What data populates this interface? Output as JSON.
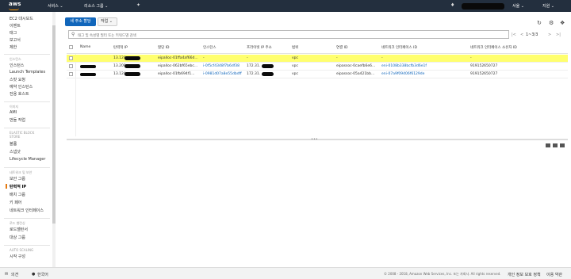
{
  "topbar": {
    "logo": "aws",
    "services": "서비스 ⌄",
    "resource_groups": "리소스 그룹 ⌄",
    "pin_icon": "pin-icon",
    "bell_icon": "bell-icon",
    "region": "서울 ⌄",
    "support": "지원 ⌄"
  },
  "sidebar": {
    "items": [
      {
        "label": "EC2 대시보드",
        "type": "item"
      },
      {
        "label": "이벤트",
        "type": "item"
      },
      {
        "label": "태그",
        "type": "item"
      },
      {
        "label": "보고서",
        "type": "item"
      },
      {
        "label": "제한",
        "type": "item"
      },
      {
        "label": "인스턴스",
        "type": "head"
      },
      {
        "label": "인스턴스",
        "type": "item"
      },
      {
        "label": "Launch Templates",
        "type": "item"
      },
      {
        "label": "스팟 요청",
        "type": "item"
      },
      {
        "label": "예약 인스턴스",
        "type": "item"
      },
      {
        "label": "전용 호스트",
        "type": "item"
      },
      {
        "label": "이미지",
        "type": "head"
      },
      {
        "label": "AMI",
        "type": "item"
      },
      {
        "label": "번들 작업",
        "type": "item"
      },
      {
        "label": "ELASTIC BLOCK",
        "type": "head"
      },
      {
        "label": "STORE",
        "type": "head2"
      },
      {
        "label": "볼륨",
        "type": "item"
      },
      {
        "label": "스냅샷",
        "type": "item"
      },
      {
        "label": "Lifecycle Manager",
        "type": "item"
      },
      {
        "label": "네트워크 및 보안",
        "type": "head"
      },
      {
        "label": "보안 그룹",
        "type": "item"
      },
      {
        "label": "탄력적 IP",
        "type": "active"
      },
      {
        "label": "배치 그룹",
        "type": "item"
      },
      {
        "label": "키 페어",
        "type": "item"
      },
      {
        "label": "네트워크 인터페이스",
        "type": "item"
      },
      {
        "label": "로드 밸런싱",
        "type": "head"
      },
      {
        "label": "로드밸런서",
        "type": "item"
      },
      {
        "label": "대상 그룹",
        "type": "item"
      },
      {
        "label": "AUTO SCALING",
        "type": "head"
      },
      {
        "label": "시작 구성",
        "type": "item"
      }
    ]
  },
  "toolbar": {
    "allocate_label": "새 주소 할당",
    "actions_label": "작업 ⌄"
  },
  "search": {
    "placeholder": "태그 및 속성별 필터 또는 키워드별 검색"
  },
  "pager": {
    "first": "|<",
    "prev": "<",
    "range": "1~3/3",
    "next": ">",
    ">|": ">|",
    "last": ">|"
  },
  "table": {
    "columns": [
      "Name",
      "탄력적 IP",
      "할당 ID",
      "인스턴스",
      "프라이빗 IP 주소",
      "범위",
      "연결 ID",
      "네트워크 인터페이스 ID",
      "네트워크 인터페이스 소유자 ID"
    ],
    "rows": [
      {
        "name": "",
        "eip": "13.124",
        "alloc": "eipalloc-01ffa4af66d...",
        "instance": "-",
        "private_ip": "-",
        "scope": "vpc",
        "assoc": "-",
        "eni": "-",
        "owner": "-",
        "selected": true
      },
      {
        "name": "",
        "eip": "13.209",
        "alloc": "eipalloc-062bf65ebc...",
        "instance": "i-0f5cf4348f7b6df38",
        "private_ip": "172.31.",
        "scope": "vpc",
        "assoc": "eipassoc-0caefb6e6...",
        "eni": "eni-0108b338bcfb3d6e1f",
        "owner": "919152650727",
        "selected": false
      },
      {
        "name": "",
        "eip": "13.124",
        "alloc": "eipalloc-01fb694f1...",
        "instance": "i-0981d07a8e55dbdff",
        "private_ip": "172.31.",
        "scope": "vpc",
        "assoc": "eipassoc-05a421bb...",
        "eni": "eni-07a9f09406f6129de",
        "owner": "919152650727",
        "selected": false
      }
    ]
  },
  "footer": {
    "feedback": "의견",
    "language": "한국어",
    "copyright": "© 2008 - 2018, Amazon Web Services, Inc. 또는 자회사. All rights reserved.",
    "privacy": "개인 정보 보호 정책",
    "terms": "이용 약관"
  }
}
